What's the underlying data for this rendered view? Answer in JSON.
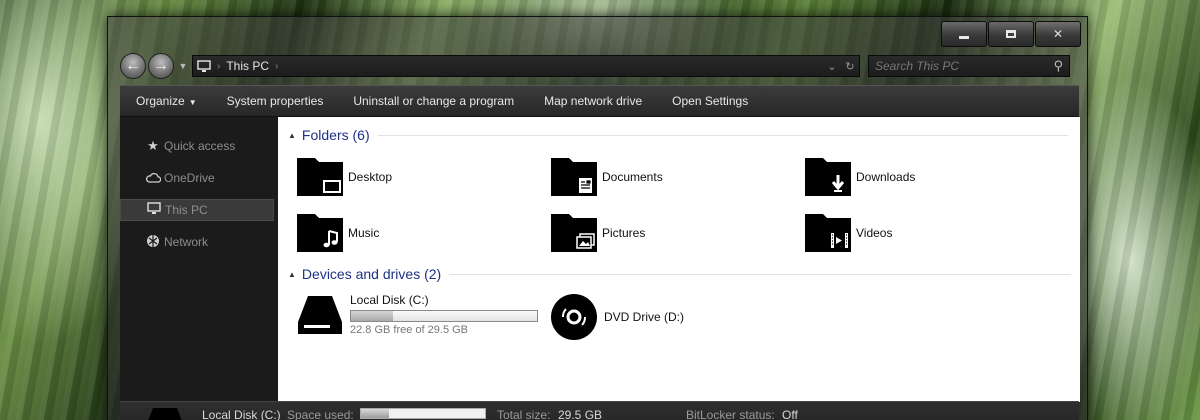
{
  "window": {
    "controls": {
      "minimize": "minimize",
      "maximize": "maximize",
      "close": "✕"
    }
  },
  "address_bar": {
    "location": "This PC",
    "back_icon": "←",
    "forward_icon": "→",
    "search_placeholder": "Search This PC"
  },
  "toolbar": {
    "items": [
      {
        "label": "Organize",
        "has_dropdown": true
      },
      {
        "label": "System properties"
      },
      {
        "label": "Uninstall or change a program"
      },
      {
        "label": "Map network drive"
      },
      {
        "label": "Open Settings"
      }
    ]
  },
  "sidebar": {
    "items": [
      {
        "label": "Quick access",
        "icon": "star-icon",
        "selected": false
      },
      {
        "label": "OneDrive",
        "icon": "cloud-icon",
        "selected": false
      },
      {
        "label": "This PC",
        "icon": "monitor-icon",
        "selected": true
      },
      {
        "label": "Network",
        "icon": "network-icon",
        "selected": false
      }
    ]
  },
  "folders": {
    "header": "Folders (6)",
    "items": [
      {
        "label": "Desktop",
        "icon": "desktop-folder-icon"
      },
      {
        "label": "Documents",
        "icon": "documents-folder-icon"
      },
      {
        "label": "Downloads",
        "icon": "downloads-folder-icon"
      },
      {
        "label": "Music",
        "icon": "music-folder-icon"
      },
      {
        "label": "Pictures",
        "icon": "pictures-folder-icon"
      },
      {
        "label": "Videos",
        "icon": "videos-folder-icon"
      }
    ]
  },
  "devices": {
    "header": "Devices and drives (2)",
    "items": [
      {
        "label": "Local Disk (C:)",
        "icon": "hard-drive-icon",
        "free_text": "22.8 GB free of 29.5 GB",
        "used_fraction": 0.227
      },
      {
        "label": "DVD Drive (D:)",
        "icon": "dvd-drive-icon"
      }
    ]
  },
  "details_pane": {
    "name": "Local Disk (C:)",
    "space_used_label": "Space used:",
    "space_used_fraction": 0.227,
    "total_size_label": "Total size:",
    "total_size_value": "29.5 GB",
    "bitlocker_label": "BitLocker status:",
    "bitlocker_value": "Off"
  },
  "colors": {
    "group_header": "#1e3287",
    "sidebar_bg": "#1b1b1b",
    "content_bg": "#ffffff"
  }
}
